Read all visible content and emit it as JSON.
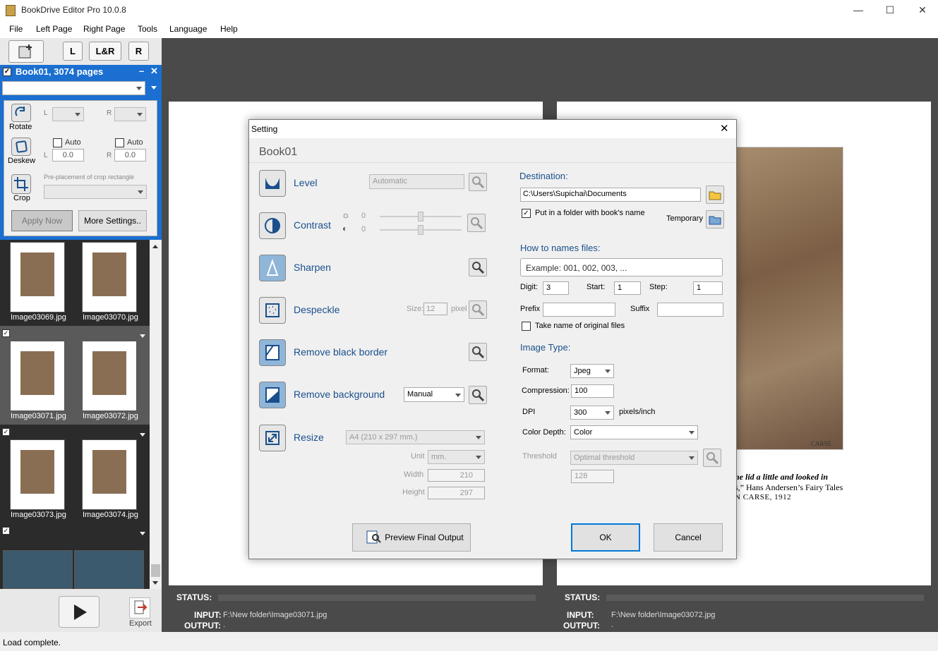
{
  "app": {
    "title": "BookDrive Editor Pro 10.0.8"
  },
  "menu": [
    "File",
    "Left Page",
    "Right Page",
    "Tools",
    "Language",
    "Help"
  ],
  "toolbar": {
    "l": "L",
    "lr": "L&R",
    "r": "R"
  },
  "book": {
    "header": "Book01, 3074 pages"
  },
  "panel": {
    "rotate": "Rotate",
    "deskew": "Deskew",
    "crop": "Crop",
    "l": "L",
    "r": "R",
    "auto": "Auto",
    "deskew_l_value": "0.0",
    "deskew_r_value": "0.0",
    "preplacement": "Pre-placement of crop rectangle",
    "apply_now": "Apply Now",
    "more_settings": "More Settings.."
  },
  "thumbnails": [
    {
      "left": "Image03069.jpg",
      "right": "Image03070.jpg"
    },
    {
      "left": "Image03071.jpg",
      "right": "Image03072.jpg"
    },
    {
      "left": "Image03073.jpg",
      "right": "Image03074.jpg"
    }
  ],
  "bottom": {
    "export": "Export"
  },
  "status": {
    "left": {
      "status_label": "STATUS:",
      "input_label": "INPUT:",
      "output_label": "OUTPUT:",
      "input": "F:\\New folder\\Image03071.jpg",
      "output": "."
    },
    "right": {
      "status_label": "STATUS:",
      "input_label": "INPUT:",
      "output_label": "OUTPUT:",
      "input": "F:\\New folder\\Image03072.jpg",
      "output": "."
    }
  },
  "statusbar": "Load complete.",
  "caption": {
    "line1": "he lid a little and looked in",
    "line2": "s,” Hans Andersen’s Fairy Tales",
    "line3": "N CARSE, 1912",
    "signature": "CARSE"
  },
  "dialog": {
    "title": "Setting",
    "book": "Book01",
    "level": {
      "label": "Level",
      "value": "Automatic"
    },
    "contrast": {
      "label": "Contrast",
      "brightness": "0",
      "contrast": "0"
    },
    "sharpen": {
      "label": "Sharpen"
    },
    "despeckle": {
      "label": "Despeckle",
      "size_label": "Size:",
      "size": "12",
      "unit": "pixel"
    },
    "remove_border": {
      "label": "Remove black border"
    },
    "remove_background": {
      "label": "Remove background",
      "value": "Manual"
    },
    "resize": {
      "label": "Resize",
      "paper": "A4 (210 x 297 mm.)",
      "unit_label": "Unit",
      "unit": "mm.",
      "width_label": "Width",
      "width": "210",
      "height_label": "Height",
      "height": "297"
    },
    "destination": {
      "label": "Destination:",
      "path": "C:\\Users\\Supichai\\Documents",
      "put_in_folder": "Put in a folder with book's name",
      "temporary": "Temporary"
    },
    "naming": {
      "label": "How to names files:",
      "example": "Example: 001, 002, 003, ...",
      "digit_label": "Digit:",
      "digit": "3",
      "start_label": "Start:",
      "start": "1",
      "step_label": "Step:",
      "step": "1",
      "prefix_label": "Prefix",
      "suffix_label": "Suffix",
      "take_original": "Take name of original files"
    },
    "image_type": {
      "label": "Image Type:",
      "format_label": "Format:",
      "format": "Jpeg",
      "compression_label": "Compression:",
      "compression": "100",
      "dpi_label": "DPI",
      "dpi": "300",
      "dpi_unit": "pixels/inch",
      "color_depth_label": "Color Depth:",
      "color_depth": "Color",
      "threshold_label": "Threshold",
      "threshold": "Optimal threshold",
      "threshold_value": "128"
    },
    "preview": "Preview Final Output",
    "ok": "OK",
    "cancel": "Cancel"
  }
}
